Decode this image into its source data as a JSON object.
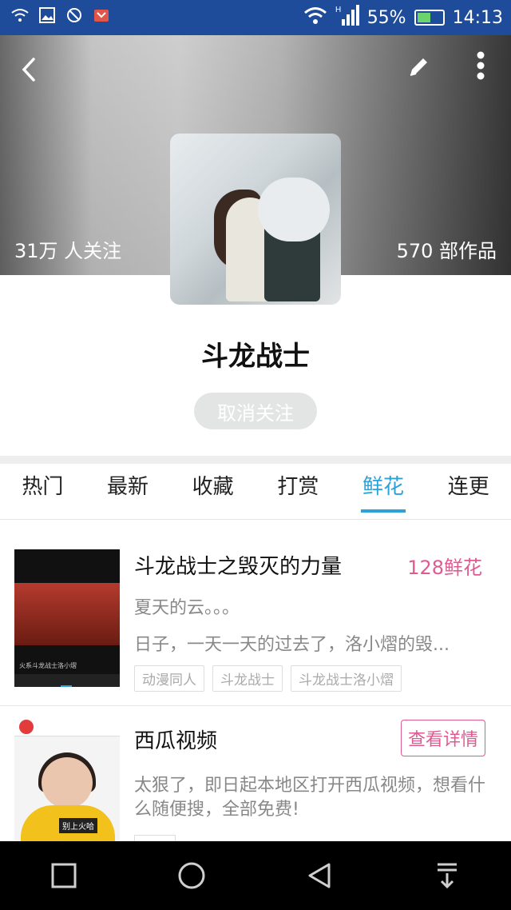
{
  "status_bar": {
    "battery_percent": "55%",
    "time": "14:13",
    "battery_level": 0.55,
    "network_label": "H"
  },
  "header": {
    "followers": "31万 人关注",
    "works": "570 部作品"
  },
  "profile": {
    "name": "斗龙战士",
    "unfollow_label": "取消关注"
  },
  "tabs": [
    {
      "label": "热门"
    },
    {
      "label": "最新"
    },
    {
      "label": "收藏"
    },
    {
      "label": "打赏"
    },
    {
      "label": "鲜花",
      "active": true
    },
    {
      "label": "连更"
    }
  ],
  "list": {
    "items": [
      {
        "title": "斗龙战士之毁灭的力量",
        "badge": "128鲜花",
        "author": "夏天的云。。。",
        "excerpt": "日子，一天一天的过去了，洛小熠的毁...",
        "tags": [
          "动漫同人",
          "斗龙战士",
          "斗龙战士洛小熠"
        ],
        "thumb_caption": "火系斗龙战士洛小熠"
      },
      {
        "title": "西瓜视频",
        "action_label": "查看详情",
        "description": "太狠了，即日起本地区打开西瓜视频，想看什么随便搜，全部免费!",
        "thumb_caption": "别上火哈"
      }
    ]
  },
  "colors": {
    "accent": "#2ba2d8",
    "pink": "#e05a92",
    "status_bar": "#1f4c9a"
  }
}
